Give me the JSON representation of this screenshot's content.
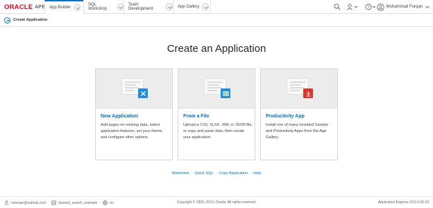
{
  "header": {
    "logo_brand": "ORACLE",
    "logo_product": "APEX",
    "tabs": [
      {
        "label": "App Builder"
      },
      {
        "label": "SQL Workshop"
      },
      {
        "label": "Team Development"
      },
      {
        "label": "App Gallery"
      }
    ],
    "user_name": "Muhammad Furqan"
  },
  "breadcrumb": {
    "label": "Create Application"
  },
  "main": {
    "title": "Create an Application",
    "cards": [
      {
        "title": "New Application",
        "description": "Add pages on existing data, select application features, set your theme, and configure other options.",
        "icon": "wrench-icon",
        "color": "#1e8fd6"
      },
      {
        "title": "From a File",
        "description": "Upload a CSV, XLSX, XML or JSON file, or copy and paste data, then create your application.",
        "icon": "table-icon",
        "color": "#1e8fd6"
      },
      {
        "title": "Productivity App",
        "description": "Install one of many included Sample and Productivity Apps from the App Gallery.",
        "icon": "download-icon",
        "color": "#d9372b"
      }
    ],
    "links": [
      "Websheet",
      "Quick SQL",
      "Copy Application",
      "Help"
    ]
  },
  "footer": {
    "email": "mfurqan@outlook.com",
    "workspace": "faceted_search_example",
    "language": "en",
    "copyright": "Copyright © 1999, 2019, Oracle. All rights reserved.",
    "version": "Application Express 19.2.0.00.18"
  },
  "colors": {
    "accent": "#0572ce",
    "brand": "#e0001b"
  }
}
